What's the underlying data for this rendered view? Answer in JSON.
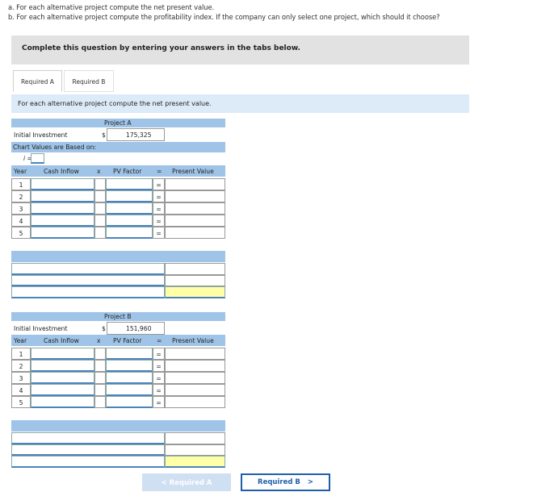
{
  "question": {
    "part_a": "a. For each alternative project compute the net present value.",
    "part_b": "b. For each alternative project compute the profitability index. If the company can only select one project, which should it choose?"
  },
  "banner": "Complete this question by entering your answers in the tabs below.",
  "tabs": [
    {
      "label": "Required A",
      "active": true
    },
    {
      "label": "Required B",
      "active": false
    }
  ],
  "instruction": "For each alternative project compute the net present value.",
  "project_a": {
    "title": "Project A",
    "initial_label": "Initial Investment",
    "currency": "$",
    "initial_value": "175,325",
    "chart_values_label": "Chart Values are Based on:",
    "i_label": "i =",
    "columns": {
      "year": "Year",
      "cash": "Cash Inflow",
      "x": "x",
      "pv": "PV Factor",
      "eq": "=",
      "present": "Present Value"
    },
    "years": [
      "1",
      "2",
      "3",
      "4",
      "5"
    ]
  },
  "project_b": {
    "title": "Project B",
    "initial_label": "Initial Investment",
    "currency": "$",
    "initial_value": "151,960",
    "columns": {
      "year": "Year",
      "cash": "Cash Inflow",
      "x": "x",
      "pv": "PV Factor",
      "eq": "=",
      "present": "Present Value"
    },
    "years": [
      "1",
      "2",
      "3",
      "4",
      "5"
    ]
  },
  "nav": {
    "prev": "< Required A",
    "next": "Required B",
    "next_arrow": ">"
  },
  "colors": {
    "header_blue": "#9fc4e7",
    "instruction_bg": "#dcebf7",
    "highlight": "#ffffa8",
    "nav_blue": "#1f5fa8"
  }
}
